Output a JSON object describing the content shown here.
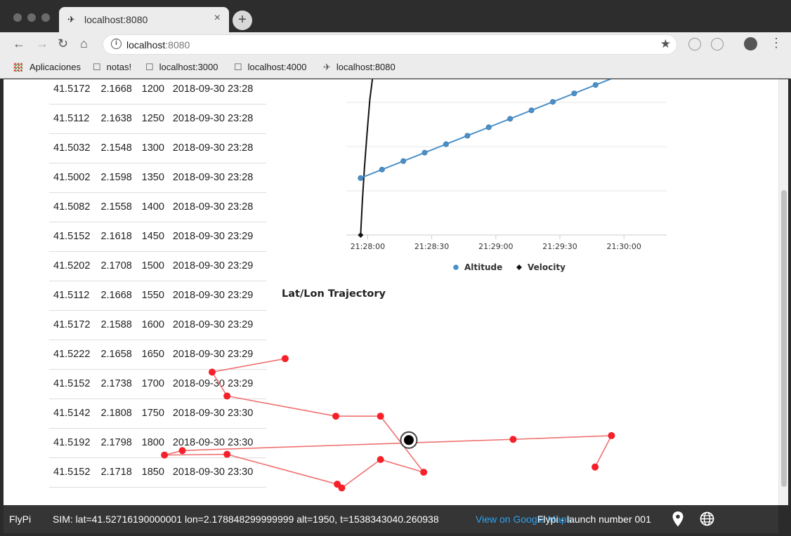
{
  "browser": {
    "tab_title": "localhost:8080",
    "url_host": "localhost",
    "url_port": ":8080",
    "bookmarks": [
      "Aplicaciones",
      "notas!",
      "localhost:3000",
      "localhost:4000",
      "localhost:8080"
    ]
  },
  "table": {
    "rows": [
      [
        "41.5172",
        "2.1668",
        "1200",
        "2018-09-30 23:28"
      ],
      [
        "41.5112",
        "2.1638",
        "1250",
        "2018-09-30 23:28"
      ],
      [
        "41.5032",
        "2.1548",
        "1300",
        "2018-09-30 23:28"
      ],
      [
        "41.5002",
        "2.1598",
        "1350",
        "2018-09-30 23:28"
      ],
      [
        "41.5082",
        "2.1558",
        "1400",
        "2018-09-30 23:28"
      ],
      [
        "41.5152",
        "2.1618",
        "1450",
        "2018-09-30 23:29"
      ],
      [
        "41.5202",
        "2.1708",
        "1500",
        "2018-09-30 23:29"
      ],
      [
        "41.5112",
        "2.1668",
        "1550",
        "2018-09-30 23:29"
      ],
      [
        "41.5172",
        "2.1588",
        "1600",
        "2018-09-30 23:29"
      ],
      [
        "41.5222",
        "2.1658",
        "1650",
        "2018-09-30 23:29"
      ],
      [
        "41.5152",
        "2.1738",
        "1700",
        "2018-09-30 23:29"
      ],
      [
        "41.5142",
        "2.1808",
        "1750",
        "2018-09-30 23:30"
      ],
      [
        "41.5192",
        "2.1798",
        "1800",
        "2018-09-30 23:30"
      ],
      [
        "41.5152",
        "2.1718",
        "1850",
        "2018-09-30 23:30"
      ]
    ]
  },
  "chart_data": [
    {
      "type": "line",
      "title": "",
      "x_ticks": [
        "21:28:00",
        "21:28:30",
        "21:29:00",
        "21:29:30",
        "21:30:00"
      ],
      "x_tick_seconds": [
        0,
        30,
        60,
        90,
        120
      ],
      "xlim_seconds": [
        -10,
        140
      ],
      "legend_position": "bottom",
      "grid": true,
      "series": [
        {
          "name": "Altitude",
          "color": "#4a8fc7",
          "marker": "circle",
          "x_seconds": [
            -3.3,
            6.7,
            16.7,
            26.7,
            36.7,
            46.7,
            56.7,
            66.7,
            76.7,
            86.7,
            96.7,
            106.7,
            116.7
          ],
          "values": [
            1200,
            1250,
            1300,
            1350,
            1400,
            1450,
            1500,
            1550,
            1600,
            1650,
            1700,
            1750,
            1800
          ]
        },
        {
          "name": "Velocity",
          "color": "#111111",
          "marker": "diamond",
          "x_seconds": [
            -3.3,
            -2.5,
            -1.5,
            -0.3,
            1.0,
            2.5,
            4.3
          ],
          "values": [
            1000,
            1200,
            1400,
            1600,
            1800,
            1950,
            2100
          ]
        }
      ],
      "ylim": [
        1000,
        1800
      ]
    },
    {
      "type": "scatter",
      "title": "Lat/Lon Trajectory",
      "connected": true,
      "xlabel": "",
      "ylabel": "",
      "series": [
        {
          "name": "",
          "color": "#f5202a",
          "points": [
            [
              2.1702,
              41.5266
            ],
            [
              2.1653,
              41.5248
            ],
            [
              2.1663,
              41.5216
            ],
            [
              2.1736,
              41.5189
            ],
            [
              2.1766,
              41.5189
            ],
            [
              2.1795,
              41.5114
            ],
            [
              2.1766,
              41.5131
            ],
            [
              2.174,
              41.5093
            ],
            [
              2.1737,
              41.5098
            ],
            [
              2.1663,
              41.5138
            ],
            [
              2.1621,
              41.5137
            ],
            [
              2.1633,
              41.5143
            ],
            [
              2.1855,
              41.5158
            ],
            [
              2.1921,
              41.5163
            ],
            [
              2.191,
              41.5121
            ]
          ]
        }
      ],
      "current_position": [
        2.1785,
        41.5157
      ],
      "xlim": [
        2.1513,
        2.2033
      ],
      "ylim": [
        41.507,
        41.533
      ]
    }
  ],
  "status": {
    "brand": "FlyPi",
    "sim": "SIM: lat=41.52716190000001 lon=2.178848299999999 alt=1950, t=1538343040.260938",
    "map_link": "View on Google Maps",
    "launch": "Flypi - launch number 001"
  }
}
